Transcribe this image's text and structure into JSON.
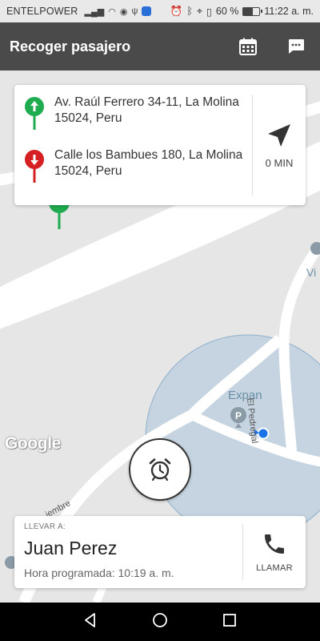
{
  "status_bar": {
    "carrier": "ENTELPOWER",
    "battery_percent": "60 %",
    "battery_level": 0.6,
    "time": "11:22 a. m."
  },
  "app_bar": {
    "title": "Recoger pasajero",
    "icons": [
      "calendar-icon",
      "message-icon"
    ]
  },
  "route": {
    "origin": "Av. Raúl Ferrero 34-11, La Molina 15024, Peru",
    "destination": "Calle los Bambues 180, La Molina 15024, Peru",
    "origin_color": "#1fab4f",
    "destination_color": "#d51f23",
    "eta": "0 MIN"
  },
  "map": {
    "provider": "Google",
    "labels": {
      "expan": "Expan",
      "vi": "Vi",
      "pedregal": "El Pedregal",
      "diciembre": "iembre"
    }
  },
  "passenger": {
    "deliver_label": "LLEVAR A:",
    "name": "Juan Perez",
    "schedule": "Hora programada: 10:19 a. m.",
    "call_label": "LLAMAR"
  },
  "nav": [
    "back-icon",
    "home-icon",
    "recents-icon"
  ]
}
